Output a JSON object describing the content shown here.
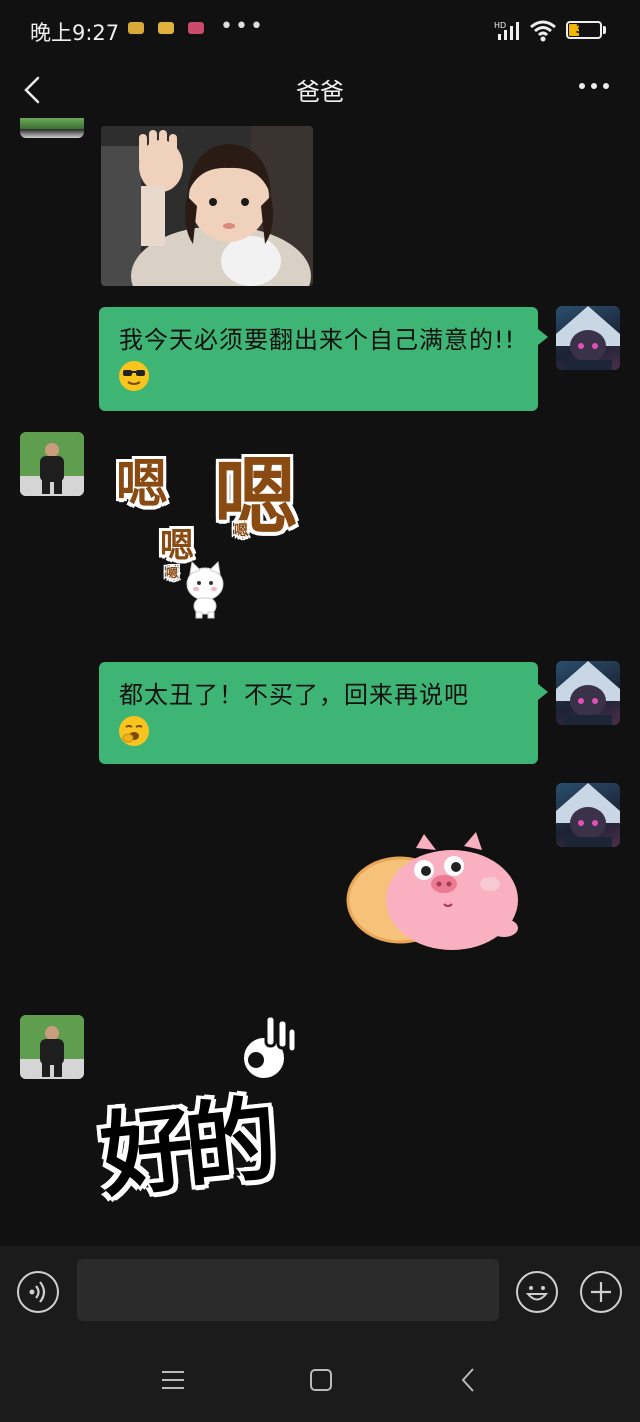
{
  "status_bar": {
    "time": "晚上9:27",
    "battery": "33",
    "battery_level": 0.33
  },
  "header": {
    "title": "爸爸"
  },
  "messages": [
    {
      "type": "image",
      "sender": "dad",
      "alt": ""
    },
    {
      "type": "text",
      "sender": "me",
      "text": "我今天必须要翻出来个自己满意的!!",
      "emoji": "sunglasses-emoji"
    },
    {
      "type": "sticker",
      "sender": "dad",
      "big": "嗯",
      "small": "嗯",
      "tiny": "嗯",
      "mini": "嗯"
    },
    {
      "type": "text",
      "sender": "me",
      "text": "都太丑了！不买了，回来再说吧",
      "emoji": "yawning-emoji"
    },
    {
      "type": "sticker",
      "sender": "me",
      "description": "pig-sticker"
    },
    {
      "type": "sticker",
      "sender": "dad",
      "text": "好的"
    }
  ],
  "colors": {
    "background": "#111111",
    "bubble_green": "#3eb574",
    "input_bar": "#1b1b1b"
  }
}
